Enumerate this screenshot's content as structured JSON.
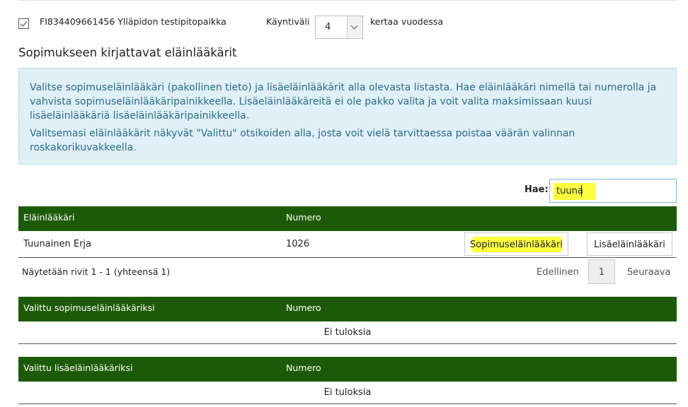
{
  "top": {
    "place_label": "FI834409661456 Ylläpidon testipitopaikka",
    "interval_label": "Käyntiväli",
    "interval_value": "4",
    "times_label": "kertaa vuodessa"
  },
  "section": {
    "title": "Sopimukseen kirjattavat eläinlääkärit"
  },
  "info": {
    "p1": "Valitse sopimuseläinlääkäri (pakollinen tieto) ja lisäeläinlääkärit alla olevasta listasta. Hae eläinlääkäri nimellä tai numerolla ja vahvista sopimuseläinlääkäripainikkeella. Lisäeläinlääkäreitä ei ole pakko valita ja voit valita maksimissaan kuusi lisäeläinlääkäriä lisäeläinlääkäripainikkeella.",
    "p2": "Valitsemasi eläinlääkärit näkyvät \"Valittu\" otsikoiden alla, josta voit vielä tarvittaessa poistaa väärän valinnan roskakorikuvakkeella."
  },
  "search": {
    "label": "Hae:",
    "value": "tuuna"
  },
  "results": {
    "headers": [
      "Eläinlääkäri",
      "Numero"
    ],
    "rows": [
      {
        "name": "Tuunainen Erja",
        "number": "1026",
        "primary_btn": "Sopimuseläinlääkäri",
        "secondary_btn": "Lisäeläinlääkäri"
      }
    ]
  },
  "pager": {
    "info": "Näytetään rivit 1 - 1 (yhteensä 1)",
    "prev": "Edellinen",
    "page": "1",
    "next": "Seuraava"
  },
  "selected_primary": {
    "headers": [
      "Valittu sopimuseläinlääkäriksi",
      "Numero"
    ],
    "empty": "Ei tuloksia"
  },
  "selected_additional": {
    "headers": [
      "Valittu lisäeläinlääkäriksi",
      "Numero"
    ],
    "empty": "Ei tuloksia"
  },
  "colors": {
    "header_green": "#1d5a07",
    "info_bg": "#dff0f6",
    "info_text": "#2d6b88",
    "highlight": "#fcff3c"
  }
}
